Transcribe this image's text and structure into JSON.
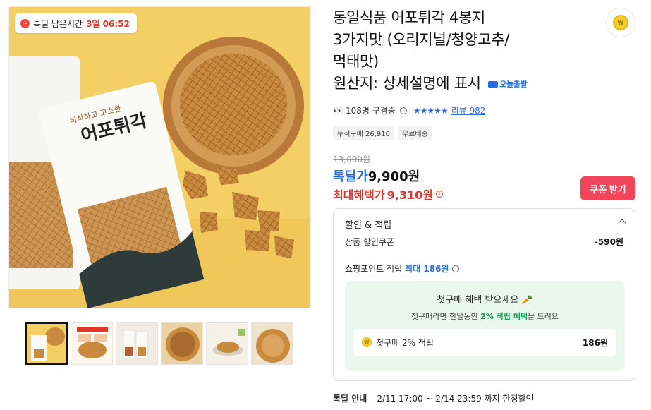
{
  "deal_timer": {
    "label": "톡딜 남은시간",
    "time_left": "3일 06:52"
  },
  "product": {
    "title_lines": [
      "동일식품 어포튀각 4봉지",
      "3가지맛 (오리지널/청양고추/",
      "먹태맛)",
      "원산지: 상세설명에 표시"
    ],
    "today_delivery_badge": "오늘출발"
  },
  "stats": {
    "viewers": "108명 구경중",
    "review_label": "리뷰 982"
  },
  "tags": [
    "누적구매 26,910",
    "무료배송"
  ],
  "price": {
    "original": "13,000원",
    "deal_label": "톡딜가",
    "deal_value": "9,900원",
    "max_benefit_label": "최대혜택가",
    "max_benefit_value": "9,310원"
  },
  "coupon_button": "쿠폰 받기",
  "discount_panel": {
    "heading": "할인 & 적립",
    "coupon_row": {
      "label": "상품 할인쿠폰",
      "amount": "-590원"
    },
    "points_row": {
      "label": "쇼핑포인트 적립",
      "max_label": "최대 186원"
    },
    "first_purchase": {
      "title": "첫구매 혜택 받으세요",
      "subtitle_prefix": "첫구매라면 한달동안",
      "subtitle_highlight": "2% 적립 혜택",
      "subtitle_suffix": "을 드려요",
      "card_label": "첫구매 2% 적립",
      "card_amount": "186원"
    }
  },
  "deal_notice": {
    "label": "톡딜 안내",
    "text": "2/11 17:00 ~ 2/14 23:59 까지 한정할인"
  },
  "package_text": [
    "어포튀각",
    "바삭하고 고소한"
  ],
  "coin_symbol": "₩",
  "colors": {
    "accent_red": "#f2455a",
    "link_blue": "#2a6fdb",
    "price_red": "#e6352b",
    "benefit_green": "#e9f7ee"
  }
}
